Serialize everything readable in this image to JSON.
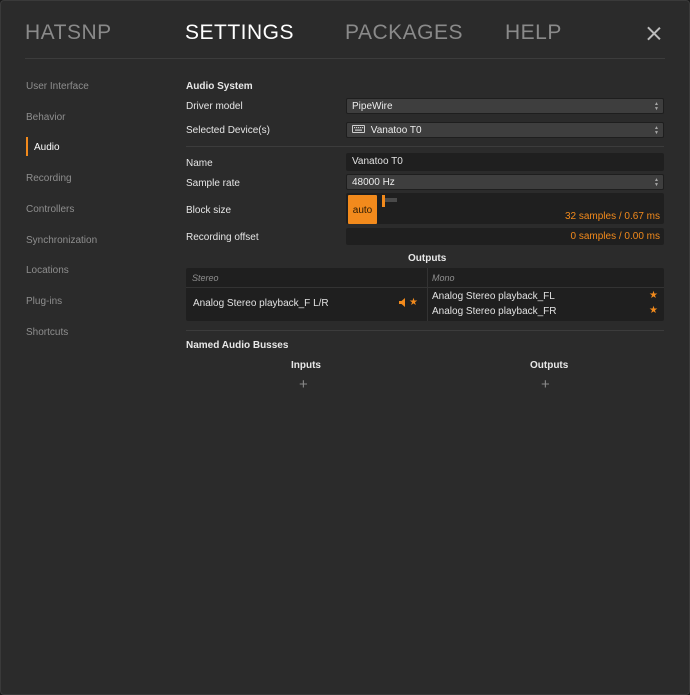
{
  "header": {
    "tabs": [
      {
        "label": "HATSNP",
        "active": false
      },
      {
        "label": "SETTINGS",
        "active": true
      },
      {
        "label": "PACKAGES",
        "active": false
      },
      {
        "label": "HELP",
        "active": false
      }
    ],
    "close_icon": "close-icon"
  },
  "sidebar": {
    "items": [
      {
        "label": "User Interface"
      },
      {
        "label": "Behavior"
      },
      {
        "label": "Audio",
        "active": true
      },
      {
        "label": "Recording"
      },
      {
        "label": "Controllers"
      },
      {
        "label": "Synchronization"
      },
      {
        "label": "Locations"
      },
      {
        "label": "Plug-ins"
      },
      {
        "label": "Shortcuts"
      }
    ]
  },
  "audio_system": {
    "heading": "Audio System",
    "driver_model_label": "Driver model",
    "driver_model_value": "PipeWire",
    "selected_devices_label": "Selected Device(s)",
    "selected_devices_value": "Vanatoo T0",
    "device_icon": "keyboard-icon"
  },
  "device": {
    "name_label": "Name",
    "name_value": "Vanatoo T0",
    "sample_rate_label": "Sample rate",
    "sample_rate_value": "48000 Hz",
    "block_size_label": "Block size",
    "block_size_auto": "auto",
    "block_size_value": "32 samples / 0.67 ms",
    "recording_offset_label": "Recording offset",
    "recording_offset_value": "0 samples / 0.00 ms"
  },
  "outputs": {
    "heading": "Outputs",
    "stereo_header": "Stereo",
    "mono_header": "Mono",
    "stereo_rows": [
      {
        "label": "Analog Stereo playback_F L/R"
      }
    ],
    "mono_rows": [
      {
        "label": "Analog Stereo playback_FL"
      },
      {
        "label": "Analog Stereo playback_FR"
      }
    ],
    "accent_color": "#f28a1c"
  },
  "named_busses": {
    "heading": "Named Audio Busses",
    "inputs_label": "Inputs",
    "outputs_label": "Outputs",
    "add_glyph": "+"
  }
}
